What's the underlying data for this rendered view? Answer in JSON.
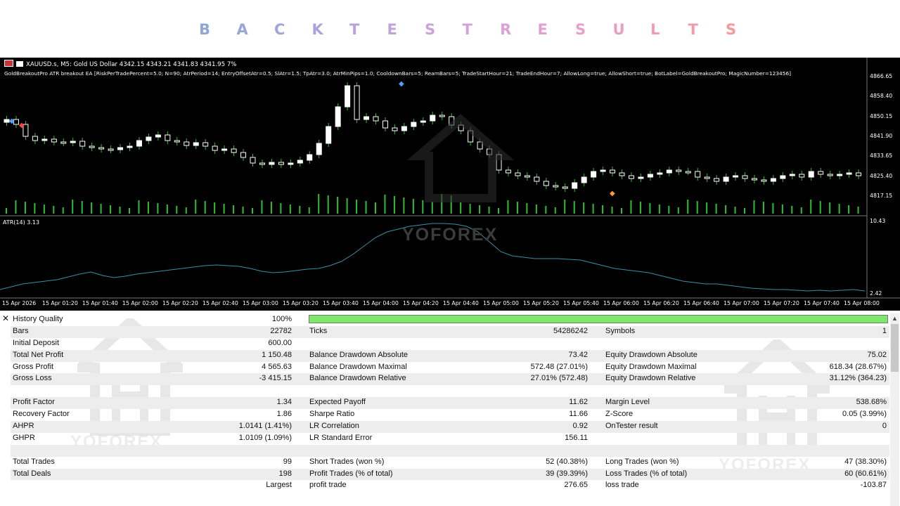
{
  "title": {
    "letters": [
      "B",
      "A",
      "C",
      "K",
      "T",
      "E",
      "S",
      "T",
      "R",
      "E",
      "S",
      "U",
      "L",
      "T",
      "S"
    ],
    "colors": [
      "#8fa6d6",
      "#97a6d8",
      "#a2a5d9",
      "#aba4da",
      "#b5a3da",
      "#c1a3dc",
      "#cba2dc",
      "#d3a2da",
      "#dca1d8",
      "#e2a0d0",
      "#e79fc8",
      "#eb9dbd",
      "#ef9cb4",
      "#f19ba8",
      "#f29a9e"
    ]
  },
  "chart": {
    "symbol_line": "XAUUSD.s, M5:  Gold US Dollar  4342.15 4343.21 4341.83 4341.95  7%",
    "params_line": "GoldBreakoutPro ATR breakout EA [RiskPerTradePercent=5.0; N=90; AtrPeriod=14; EntryOffsetAtr=0.5; SlAtr=1.5; TpAtr=3.0; AtrMinPips=1.0; CooldownBars=5; ReamBars=5; TradeStartHour=21; TradeEndHour=7; AllowLong=true; AllowShort=true; BotLabel=GoldBreakoutPro; MagicNumber=123456]",
    "price_labels": [
      "4866.65",
      "4858.40",
      "4850.15",
      "4841.90",
      "4833.65",
      "4825.40",
      "4817.15"
    ],
    "atr_label": "ATR(14) 3.13",
    "atr_axis": [
      "10.43",
      "2.42"
    ],
    "time_labels": [
      "15 Apr 2026",
      "15 Apr 01:20",
      "15 Apr 01:40",
      "15 Apr 02:00",
      "15 Apr 02:20",
      "15 Apr 02:40",
      "15 Apr 03:00",
      "15 Apr 03:20",
      "15 Apr 03:40",
      "15 Apr 04:00",
      "15 Apr 04:20",
      "15 Apr 04:40",
      "15 Apr 05:00",
      "15 Apr 05:20",
      "15 Apr 05:40",
      "15 Apr 06:00",
      "15 Apr 06:20",
      "15 Apr 06:40",
      "15 Apr 07:00",
      "15 Apr 07:20",
      "15 Apr 07:40",
      "15 Apr 08:00"
    ],
    "watermark": "YOFOREX",
    "colors": {
      "background": "#000000",
      "bull": "#ffffff",
      "bear": "#000000",
      "volume": "#2fbf2f",
      "atr": "#3a8fa6",
      "wick": "#2fbf2f"
    }
  },
  "report": {
    "history_quality": {
      "label": "History Quality",
      "value": "100%",
      "fill": 1.0
    },
    "rows": [
      [
        "Bars",
        "22782",
        "Ticks",
        "54286242",
        "Symbols",
        "1"
      ],
      [
        "Initial Deposit",
        "600.00",
        "",
        "",
        "",
        ""
      ],
      [
        "Total Net Profit",
        "1 150.48",
        "Balance Drawdown Absolute",
        "73.42",
        "Equity Drawdown Absolute",
        "75.02"
      ],
      [
        "Gross Profit",
        "4 565.63",
        "Balance Drawdown Maximal",
        "572.48 (27.01%)",
        "Equity Drawdown Maximal",
        "618.34 (28.67%)"
      ],
      [
        "Gross Loss",
        "-3 415.15",
        "Balance Drawdown Relative",
        "27.01% (572.48)",
        "Equity Drawdown Relative",
        "31.12% (364.23)"
      ],
      [
        "",
        "",
        "",
        "",
        "",
        ""
      ],
      [
        "Profit Factor",
        "1.34",
        "Expected Payoff",
        "11.62",
        "Margin Level",
        "538.68%"
      ],
      [
        "Recovery Factor",
        "1.86",
        "Sharpe Ratio",
        "11.66",
        "Z-Score",
        "0.05 (3.99%)"
      ],
      [
        "AHPR",
        "1.0141 (1.41%)",
        "LR Correlation",
        "0.92",
        "OnTester result",
        "0"
      ],
      [
        "GHPR",
        "1.0109 (1.09%)",
        "LR Standard Error",
        "156.11",
        "",
        ""
      ],
      [
        "",
        "",
        "",
        "",
        "",
        ""
      ],
      [
        "Total Trades",
        "99",
        "Short Trades (won %)",
        "52 (40.38%)",
        "Long Trades (won %)",
        "47 (38.30%)"
      ],
      [
        "Total Deals",
        "198",
        "Profit Trades (% of total)",
        "39 (39.39%)",
        "Loss Trades (% of total)",
        "60 (60.61%)"
      ],
      [
        "",
        "Largest",
        "profit trade",
        "276.65",
        "loss trade",
        "-103.87"
      ]
    ],
    "watermark": "YOFOREX"
  }
}
